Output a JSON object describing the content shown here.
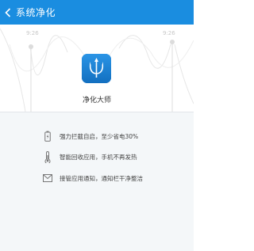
{
  "header": {
    "title": "系统净化",
    "background": "#1a8de0"
  },
  "hero": {
    "tick_left": "9:26",
    "tick_right": "9:26",
    "app_name": "净化大师",
    "icon": "trident-icon",
    "icon_color": "#1e86d8"
  },
  "features": [
    {
      "icon": "battery-icon",
      "text": "强力拦截自启，至少省电30%"
    },
    {
      "icon": "thermometer-icon",
      "text": "智能回收应用，手机不再发热"
    },
    {
      "icon": "envelope-icon",
      "text": "接管应用通知，通知栏干净整洁"
    }
  ]
}
